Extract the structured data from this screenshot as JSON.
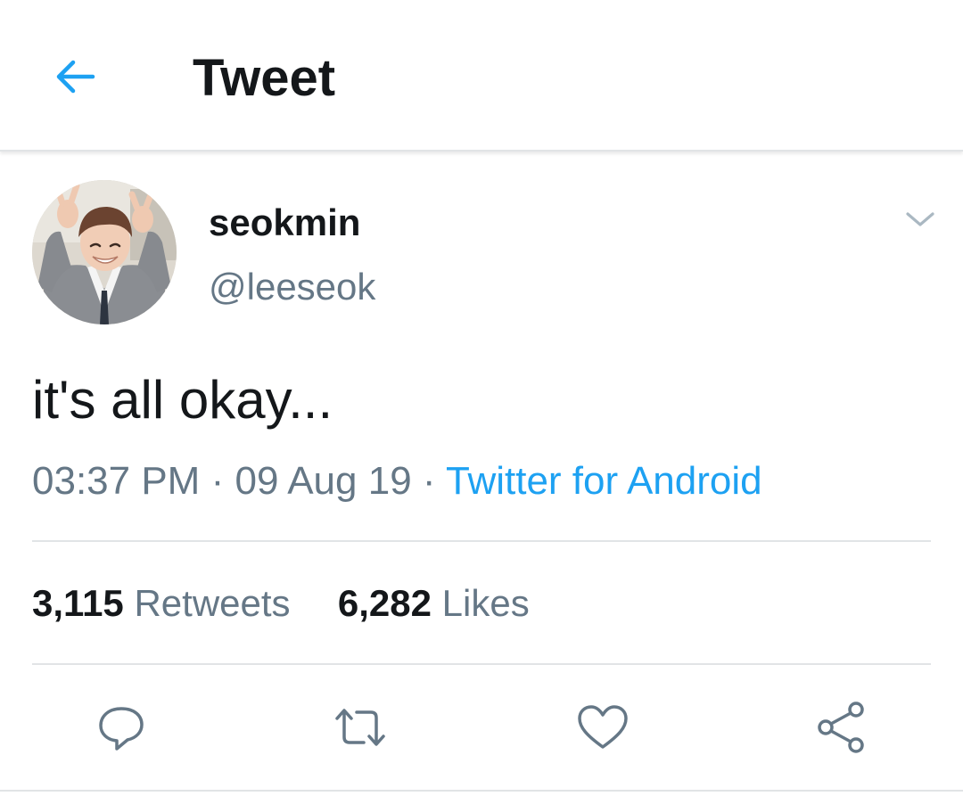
{
  "header": {
    "title": "Tweet",
    "back_icon": "arrow-left-icon"
  },
  "tweet": {
    "author": {
      "display_name": "seokmin",
      "handle": "@leeseok"
    },
    "text": "it's all okay...",
    "time": "03:37 PM",
    "separator": "·",
    "date": "09 Aug 19",
    "source": "Twitter for Android",
    "stats": {
      "retweets_count": "3,115",
      "retweets_label": "Retweets",
      "likes_count": "6,282",
      "likes_label": "Likes"
    }
  },
  "actions": {
    "icons": [
      "reply-icon",
      "retweet-icon",
      "like-icon",
      "share-icon"
    ]
  },
  "colors": {
    "accent": "#1da1f2",
    "text_primary": "#14171a",
    "text_secondary": "#657786",
    "divider": "#e1e4e6"
  }
}
